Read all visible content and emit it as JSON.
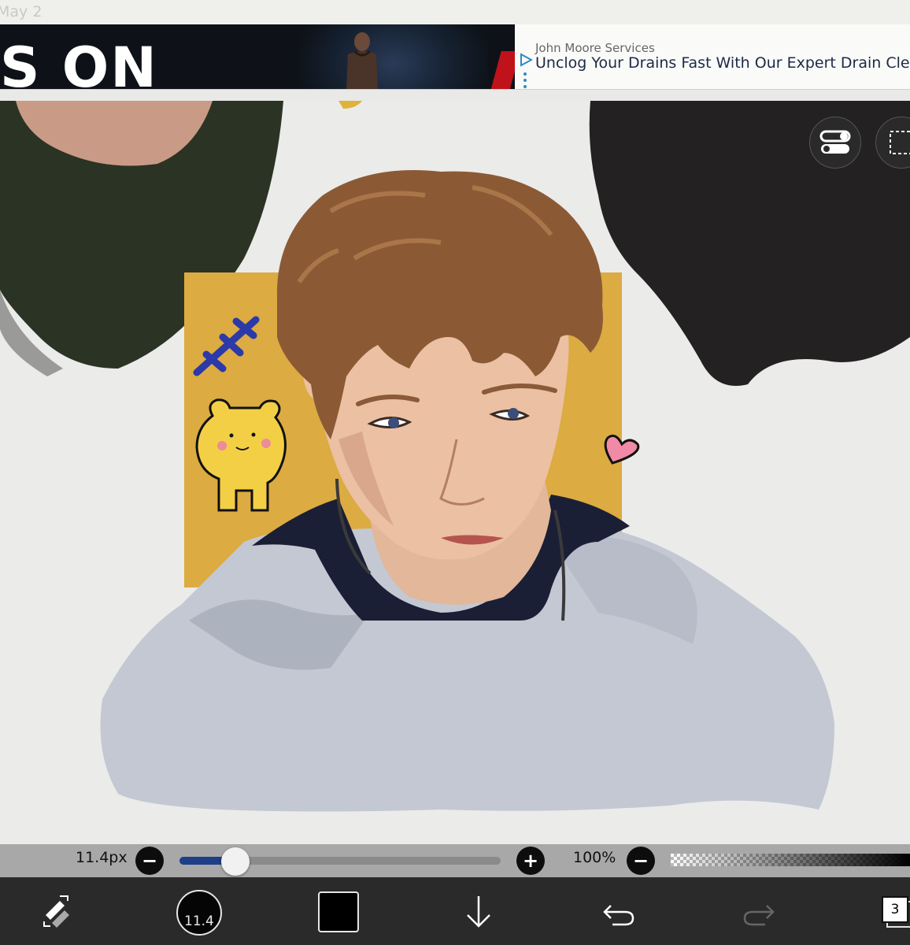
{
  "status_bar": {
    "date": "May 2"
  },
  "ad": {
    "banner_text": "S ON",
    "sponsor": "John Moore Services",
    "headline": "Unclog Your Drains Fast With Our Expert Drain Clean",
    "play_icon": "ad-choices-play-icon",
    "menu_icon": "vertical-dots-icon"
  },
  "canvas": {
    "artwork": "digital-portrait-sketch",
    "background_color": "#ebebea",
    "accent_square_color": "#dcab41",
    "buttons": {
      "settings_icon": "toggle-switches-icon",
      "selection_icon": "dashed-selection-icon"
    }
  },
  "brush_bar": {
    "size_label": "11.4px",
    "size_fraction": 0.13,
    "minus_icon": "−",
    "plus_icon": "+",
    "opacity_label": "100%",
    "opacity_fraction": 1.0
  },
  "toolbar": {
    "brush_preview_label": "11.4",
    "current_color": "#000000",
    "layer_count": "3",
    "icons": [
      "brush-eraser-swap-icon",
      "arrow-down-icon",
      "undo-icon",
      "redo-icon",
      "layers-icon"
    ]
  }
}
